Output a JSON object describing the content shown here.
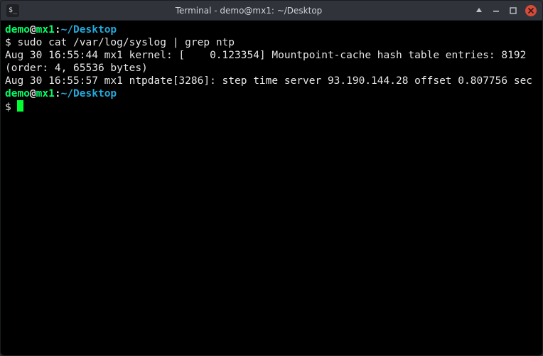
{
  "window": {
    "app_icon_text": "$_",
    "title": "Terminal - demo@mx1: ~/Desktop"
  },
  "prompt": {
    "user": "demo",
    "at": "@",
    "host": "mx1",
    "colon": ":",
    "path": "~/Desktop",
    "symbol": "$ "
  },
  "session": {
    "command1": "sudo cat /var/log/syslog | grep ntp",
    "output1": "Aug 30 16:55:44 mx1 kernel: [    0.123354] Mountpoint-cache hash table entries: 8192 (order: 4, 65536 bytes)",
    "output2": "Aug 30 16:55:57 mx1 ntpdate[3286]: step time server 93.190.144.28 offset 0.807756 sec"
  },
  "colors": {
    "prompt_user": "#00ff66",
    "prompt_path": "#23a8d8",
    "terminal_bg": "#000000",
    "cursor": "#00ff33",
    "close_btn": "#d64b3a"
  },
  "icons": {
    "app": "terminal-icon",
    "keep_above": "keep-above-icon",
    "minimize": "minimize-icon",
    "maximize": "maximize-icon",
    "close": "close-icon"
  }
}
